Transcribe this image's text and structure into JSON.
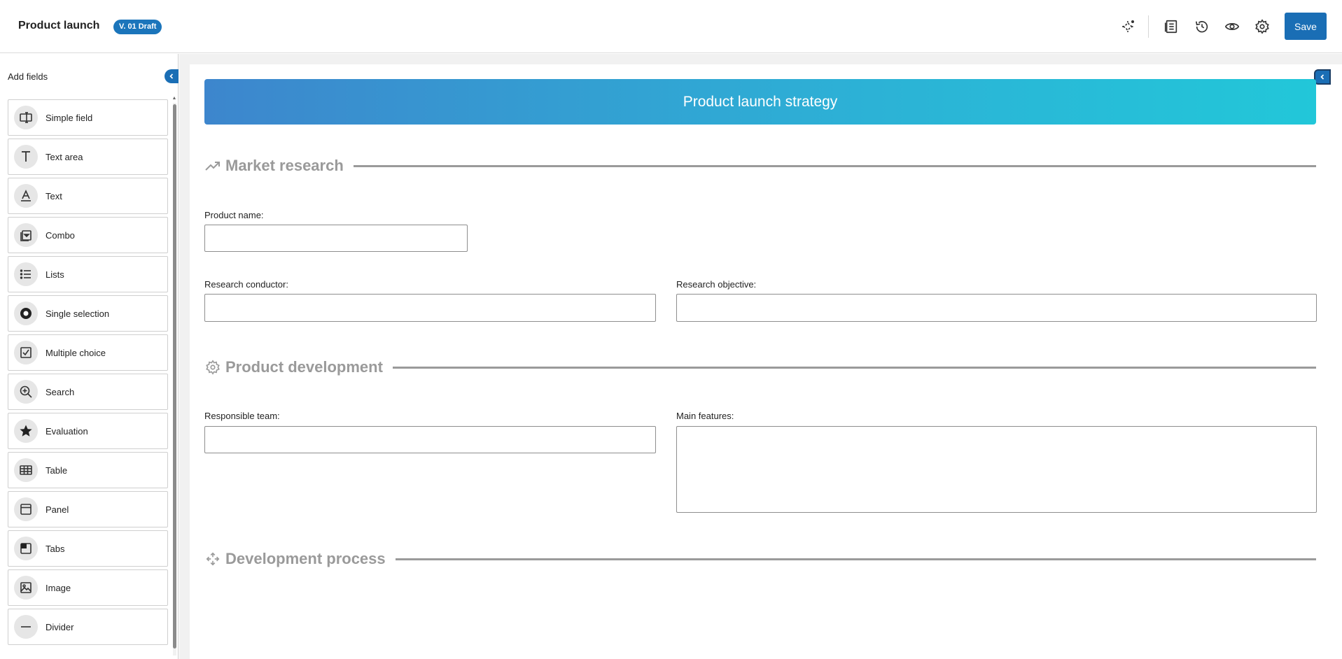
{
  "header": {
    "title": "Product launch",
    "version_badge": "V. 01 Draft",
    "save_label": "Save",
    "icons": [
      "ai-magic-icon",
      "layout-icon",
      "history-icon",
      "preview-icon",
      "settings-icon"
    ]
  },
  "sidebar": {
    "title": "Add fields",
    "items": [
      {
        "label": "Simple field",
        "icon": "simple-field-icon"
      },
      {
        "label": "Text area",
        "icon": "text-area-icon"
      },
      {
        "label": "Text",
        "icon": "text-icon"
      },
      {
        "label": "Combo",
        "icon": "combo-icon"
      },
      {
        "label": "Lists",
        "icon": "lists-icon"
      },
      {
        "label": "Single selection",
        "icon": "radio-icon"
      },
      {
        "label": "Multiple choice",
        "icon": "checkbox-icon"
      },
      {
        "label": "Search",
        "icon": "search-icon"
      },
      {
        "label": "Evaluation",
        "icon": "star-icon"
      },
      {
        "label": "Table",
        "icon": "table-icon"
      },
      {
        "label": "Panel",
        "icon": "panel-icon"
      },
      {
        "label": "Tabs",
        "icon": "tabs-icon"
      },
      {
        "label": "Image",
        "icon": "image-icon"
      },
      {
        "label": "Divider",
        "icon": "divider-icon"
      }
    ]
  },
  "form": {
    "banner_title": "Product launch strategy",
    "sections": {
      "market_research": "Market research",
      "product_development": "Product development",
      "development_process": "Development process"
    },
    "fields": {
      "product_name": {
        "label": "Product name:",
        "value": ""
      },
      "research_conductor": {
        "label": "Research conductor:",
        "value": ""
      },
      "research_objective": {
        "label": "Research objective:",
        "value": ""
      },
      "responsible_team": {
        "label": "Responsible team:",
        "value": ""
      },
      "main_features": {
        "label": "Main features:",
        "value": ""
      }
    }
  },
  "colors": {
    "accent": "#1a6eb5",
    "banner_start": "#3d86cd",
    "banner_end": "#22c7d9",
    "section_title": "#9a9a9a"
  }
}
